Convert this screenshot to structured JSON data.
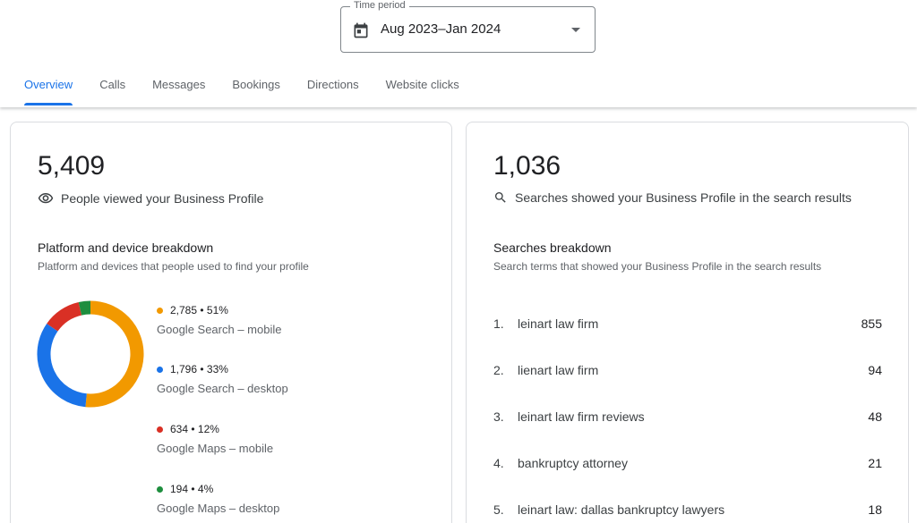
{
  "time_period": {
    "legend": "Time period",
    "value": "Aug 2023–Jan 2024",
    "icon": "calendar-icon"
  },
  "tabs": [
    {
      "label": "Overview",
      "active": true
    },
    {
      "label": "Calls",
      "active": false
    },
    {
      "label": "Messages",
      "active": false
    },
    {
      "label": "Bookings",
      "active": false
    },
    {
      "label": "Directions",
      "active": false
    },
    {
      "label": "Website clicks",
      "active": false
    }
  ],
  "views_card": {
    "total": "5,409",
    "description": "People viewed your Business Profile",
    "icon": "eye-icon",
    "breakdown_title": "Platform and device breakdown",
    "breakdown_subtitle": "Platform and devices that people used to find your profile"
  },
  "chart_data": {
    "type": "pie",
    "categories": [
      "Google Search – mobile",
      "Google Search – desktop",
      "Google Maps – mobile",
      "Google Maps – desktop"
    ],
    "values": [
      2785,
      1796,
      634,
      194
    ],
    "percent_labels": [
      "51%",
      "33%",
      "12%",
      "4%"
    ],
    "value_labels": [
      "2,785",
      "1,796",
      "634",
      "194"
    ],
    "colors": [
      "#f29900",
      "#1a73e8",
      "#d93025",
      "#1e8e3e"
    ]
  },
  "searches_card": {
    "total": "1,036",
    "description": "Searches showed your Business Profile in the search results",
    "icon": "search-icon",
    "breakdown_title": "Searches breakdown",
    "breakdown_subtitle": "Search terms that showed your Business Profile in the search results",
    "rows": [
      {
        "index": "1.",
        "term": "leinart law firm",
        "count": "855"
      },
      {
        "index": "2.",
        "term": "lienart law firm",
        "count": "94"
      },
      {
        "index": "3.",
        "term": "leinart law firm reviews",
        "count": "48"
      },
      {
        "index": "4.",
        "term": "bankruptcy attorney",
        "count": "21"
      },
      {
        "index": "5.",
        "term": "leinart law: dallas bankruptcy lawyers",
        "count": "18"
      }
    ]
  }
}
